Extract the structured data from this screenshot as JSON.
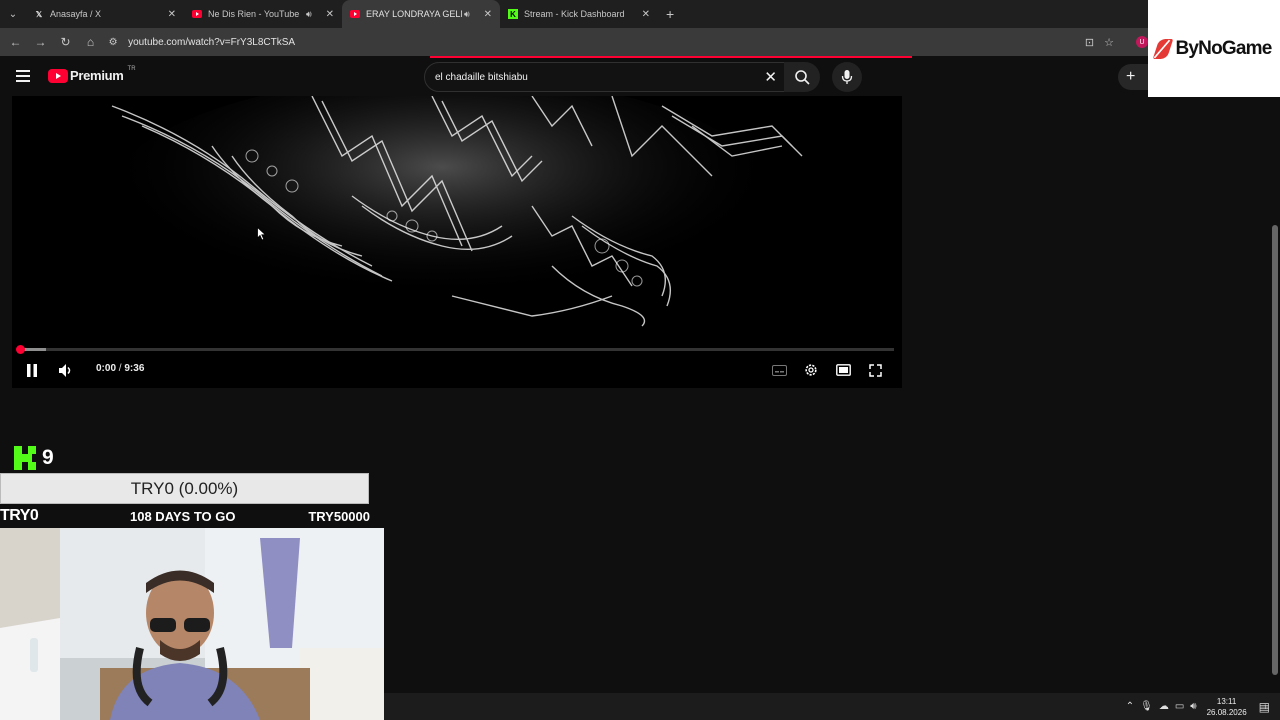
{
  "browser": {
    "tabs": [
      {
        "label": "Anasayfa / X",
        "favicon": "x-icon",
        "active": false,
        "audio": false
      },
      {
        "label": "Ne Dis Rien - YouTube",
        "favicon": "youtube-icon",
        "active": false,
        "audio": true
      },
      {
        "label": "ERAY LONDRAYA GELMİŞ",
        "favicon": "youtube-icon",
        "active": true,
        "audio": true
      },
      {
        "label": "Stream - Kick Dashboard",
        "favicon": "kick-icon",
        "active": false,
        "audio": false
      }
    ],
    "url": "youtube.com/watch?v=FrY3L8CTkSA"
  },
  "youtube": {
    "logo_text": "Premium",
    "country_code": "TR",
    "search_query": "el chadaille bitshiabu"
  },
  "sponsor": {
    "logo_text": "ByNoGame"
  },
  "player": {
    "current_time": "0:00",
    "separator": "/",
    "duration": "9:36",
    "played_fraction": 0.0,
    "buffered_fraction": 0.03,
    "state": "playing"
  },
  "stream_overlay": {
    "kick_count": "9",
    "goal_bar_text": "TRY0 (0.00%)",
    "goal_progress_fraction": 0.0,
    "goal_current": "TRY0",
    "goal_days": "108 DAYS TO GO",
    "goal_target": "TRY50000"
  },
  "taskbar": {
    "time": "13:11",
    "date": "26.08.2026",
    "notifications": "1"
  },
  "colors": {
    "youtube_red": "#ff0033",
    "kick_green": "#53fc18",
    "background": "#0f0f0f"
  }
}
